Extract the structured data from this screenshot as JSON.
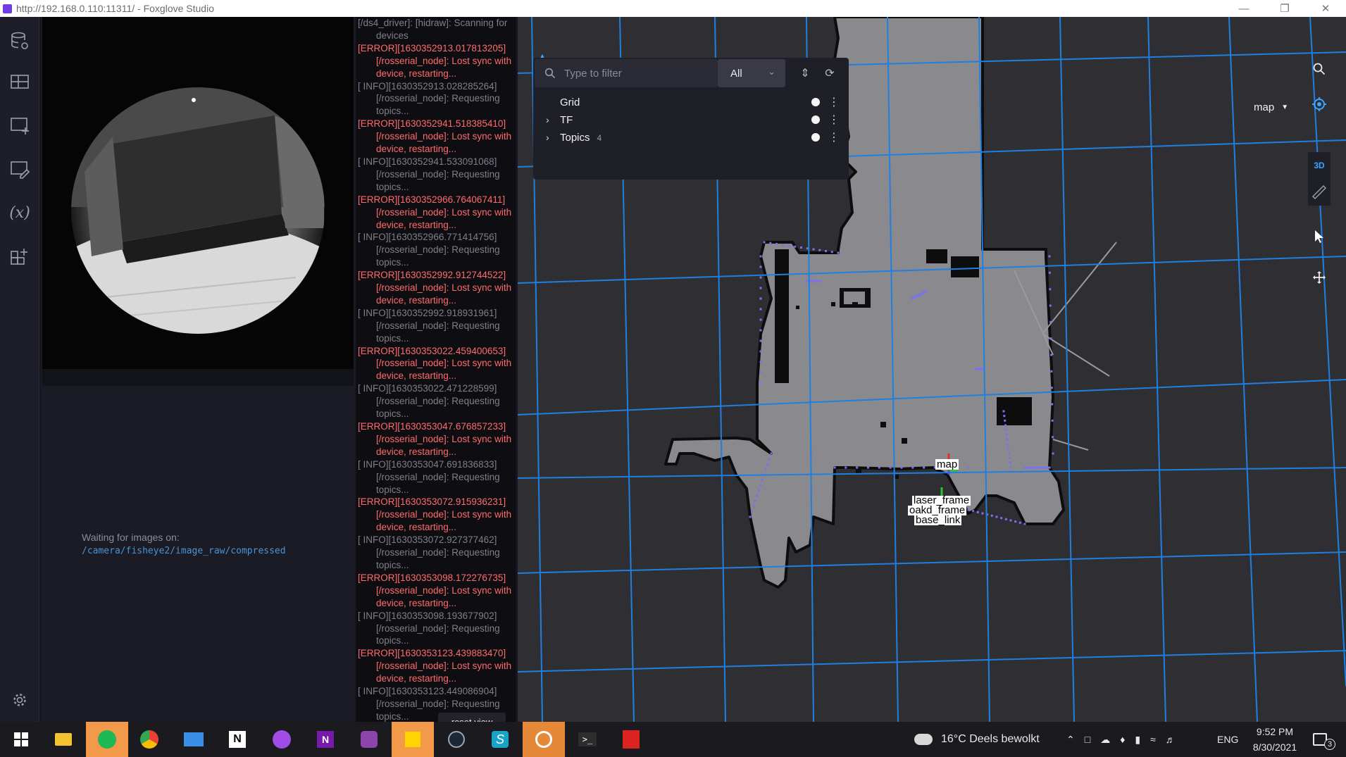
{
  "titlebar": {
    "title": "http://192.168.0.110:11311/ - Foxglove Studio"
  },
  "image_panel": {
    "waiting_text": "Waiting for images on:",
    "topic": "/camera/fisheye2/image_raw/compressed"
  },
  "log": {
    "lines": [
      {
        "level": "info",
        "text": "[/ds4_driver]: [hidraw]: Scanning for devices"
      },
      {
        "level": "error",
        "text": "[ERROR][1630352913.017813205] [/rosserial_node]: Lost sync with device, restarting..."
      },
      {
        "level": "info",
        "text": "[ INFO][1630352913.028285264] [/rosserial_node]: Requesting topics..."
      },
      {
        "level": "error",
        "text": "[ERROR][1630352941.518385410] [/rosserial_node]: Lost sync with device, restarting..."
      },
      {
        "level": "info",
        "text": "[ INFO][1630352941.533091068] [/rosserial_node]: Requesting topics..."
      },
      {
        "level": "error",
        "text": "[ERROR][1630352966.764067411] [/rosserial_node]: Lost sync with device, restarting..."
      },
      {
        "level": "info",
        "text": "[ INFO][1630352966.771414756] [/rosserial_node]: Requesting topics..."
      },
      {
        "level": "error",
        "text": "[ERROR][1630352992.912744522] [/rosserial_node]: Lost sync with device, restarting..."
      },
      {
        "level": "info",
        "text": "[ INFO][1630352992.918931961] [/rosserial_node]: Requesting topics..."
      },
      {
        "level": "error",
        "text": "[ERROR][1630353022.459400653] [/rosserial_node]: Lost sync with device, restarting..."
      },
      {
        "level": "info",
        "text": "[ INFO][1630353022.471228599] [/rosserial_node]: Requesting topics..."
      },
      {
        "level": "error",
        "text": "[ERROR][1630353047.676857233] [/rosserial_node]: Lost sync with device, restarting..."
      },
      {
        "level": "info",
        "text": "[ INFO][1630353047.691836833] [/rosserial_node]: Requesting topics..."
      },
      {
        "level": "error",
        "text": "[ERROR][1630353072.915936231] [/rosserial_node]: Lost sync with device, restarting..."
      },
      {
        "level": "info",
        "text": "[ INFO][1630353072.927377462] [/rosserial_node]: Requesting topics..."
      },
      {
        "level": "error",
        "text": "[ERROR][1630353098.172276735] [/rosserial_node]: Lost sync with device, restarting..."
      },
      {
        "level": "info",
        "text": "[ INFO][1630353098.193677902] [/rosserial_node]: Requesting topics..."
      },
      {
        "level": "error",
        "text": "[ERROR][1630353123.439883470] [/rosserial_node]: Lost sync with device, restarting..."
      },
      {
        "level": "info",
        "text": "[ INFO][1630353123.449086904] [/rosserial_node]: Requesting topics..."
      }
    ]
  },
  "scene": {
    "reset_view_label": "reset view",
    "filter_placeholder": "Type to filter",
    "filter_value": "All",
    "layers": [
      {
        "name": "Grid",
        "expandable": false,
        "count": ""
      },
      {
        "name": "TF",
        "expandable": true,
        "count": ""
      },
      {
        "name": "Topics",
        "expandable": true,
        "count": "4"
      }
    ],
    "follow_frame": "map",
    "mode_3d_label": "3D",
    "frame_labels": {
      "map": "map",
      "laser_frame": "laser_frame",
      "oakd_frame": "oakd_frame",
      "base_link": "base_link"
    }
  },
  "taskbar": {
    "weather": "16°C  Deels bewolkt",
    "language": "ENG",
    "time": "9:52 PM",
    "date": "8/30/2021",
    "notifications": "3"
  },
  "colors": {
    "error": "#ff6b6b",
    "info": "#7f7f8a",
    "accent": "#3ba6ff",
    "grid": "#1f7fe0",
    "map_free": "#8a8a8e",
    "laser": "#7a70f0"
  }
}
